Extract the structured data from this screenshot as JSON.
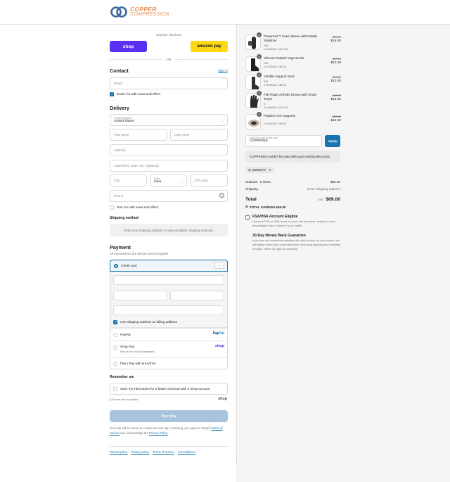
{
  "brand": {
    "line1": "COPPER",
    "line2": "COMPRESSION"
  },
  "express": {
    "title": "Express checkout",
    "shop_label": "shop",
    "amazon_label": "amazon pay",
    "or": "OR"
  },
  "contact": {
    "heading": "Contact",
    "sign_in": "Sign in",
    "email_placeholder": "Email",
    "news_label": "Email me with news and offers"
  },
  "delivery": {
    "heading": "Delivery",
    "country_caption": "Country/Region",
    "country_value": "United States",
    "first_name": "First name",
    "last_name": "Last name",
    "address": "Address",
    "apartment": "Apartment, suite, etc. (optional)",
    "city": "City",
    "state_caption": "State",
    "state_value": "Iowa",
    "zip": "ZIP code",
    "phone": "Phone",
    "text_label": "Text me with news and offers"
  },
  "shipping": {
    "heading": "Shipping method",
    "note": "Enter your shipping address to view available shipping methods."
  },
  "payment": {
    "heading": "Payment",
    "subtitle": "All transactions are secure and encrypted.",
    "credit_card": "Credit card",
    "billing_label": "Use shipping address as billing address",
    "paypal": "PayPal",
    "shop_pay": "Shop Pay",
    "shop_pay_sub": "Pay in full or in installments",
    "shop_pay_logo": "shop",
    "flex": "Flex | Pay with HSA/FSA"
  },
  "remember": {
    "heading": "Remember me",
    "save_label": "Save my information for a faster checkout with a Shop account",
    "secure": "Secure and encrypted",
    "shop_logo": "shop"
  },
  "pay_button": "Pay now",
  "terms": {
    "text1": "Your info will be saved to a Shop account. By continuing, you agree to Shop's",
    "tos": "Terms of Service",
    "text2": "and acknowledge the",
    "privacy": "Privacy Policy."
  },
  "footer": [
    "Refund policy",
    "Privacy policy",
    "Terms of service",
    "Cancellations"
  ],
  "cart": {
    "items": [
      {
        "qty": "1",
        "name": "PowerKnit™ Knee Sleeve with Patella Stabilizer",
        "variant": "S/M",
        "discount": "MONDAY (-$10.00)",
        "old_price": "$25.00",
        "price": "$15.00"
      },
      {
        "qty": "1",
        "name": "Silicone Padded Yoga Socks",
        "variant": "S/M",
        "discount": "MONDAY (-$8.00)",
        "old_price": "$20.00",
        "price": "$12.00"
      },
      {
        "qty": "1",
        "name": "Achilles Support Sock",
        "variant": "S/M",
        "discount": "MONDAY (-$8.00)",
        "old_price": "$20.00",
        "price": "$12.00"
      },
      {
        "qty": "1",
        "name": "Full Finger Arthritis Gloves with Smart Touch",
        "variant": "S",
        "discount": "MONDAY (-$12.00)",
        "old_price": "$30.00",
        "price": "$18.00"
      },
      {
        "qty": "1",
        "name": "Padded Arch Supports",
        "variant": "",
        "discount": "MONDAY (-$8.00)",
        "old_price": "$20.00",
        "price": "$12.00"
      }
    ],
    "discount_caption": "Discount code or gift card",
    "discount_value": "COPPER50",
    "apply": "Apply",
    "error": "COPPER50 couldn't be used with your existing discounts.",
    "tag": "MONDAY",
    "subtotal_label": "Subtotal · 5 items",
    "subtotal_value": "$69.00",
    "shipping_label": "Shipping",
    "shipping_value": "Enter shipping address",
    "total_label": "Total",
    "currency": "USD",
    "total_value": "$69.00",
    "savings": "TOTAL SAVINGS  $46.00"
  },
  "highlights": [
    {
      "title": "FSA/HSA Account Eligible",
      "desc": "Use your FSA or HSA funds to cover this purchase, making it a tax-advantaged way to invest in your health."
    },
    {
      "title": "30-Day Money Back Guarantee",
      "desc": "If you are not completely satisfied with this product for any reason, We will gladly refund your purchase price, excluding shipping and handling charges, within 30 days of purchase."
    }
  ]
}
